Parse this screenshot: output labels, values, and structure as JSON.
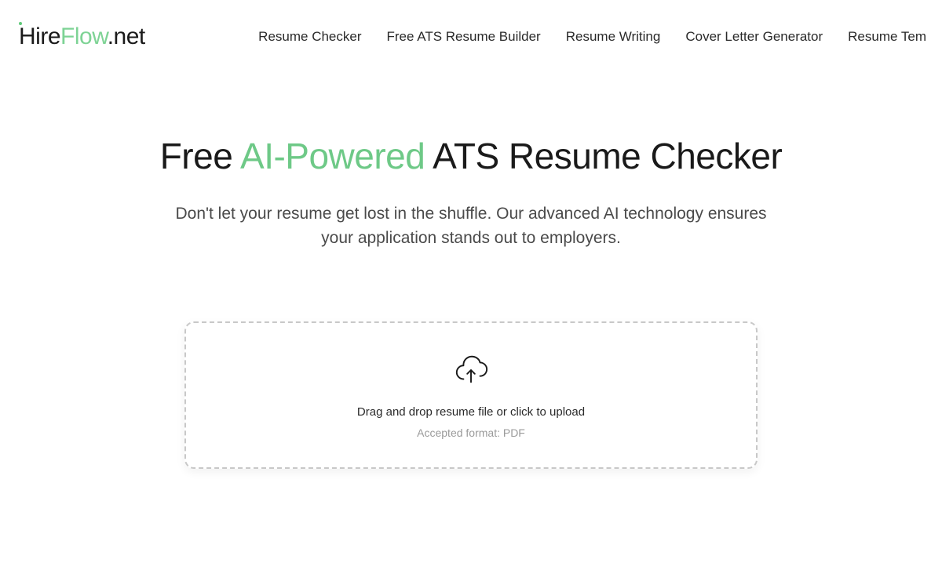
{
  "logo": {
    "part1": "Hire",
    "part2": "Flow",
    "part3": ".net"
  },
  "nav": {
    "items": [
      "Resume Checker",
      "Free ATS Resume Builder",
      "Resume Writing",
      "Cover Letter Generator",
      "Resume Tem"
    ]
  },
  "hero": {
    "title_prefix": "Free ",
    "title_accent": "AI-Powered",
    "title_suffix": " ATS Resume Checker",
    "subtitle": "Don't let your resume get lost in the shuffle. Our advanced AI technology ensures your application stands out to employers."
  },
  "upload": {
    "text": "Drag and drop resume file or click to upload",
    "format": "Accepted format: PDF"
  }
}
